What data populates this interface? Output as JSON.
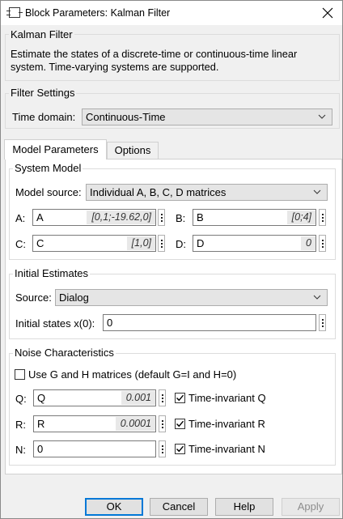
{
  "window": {
    "title": "Block Parameters: Kalman Filter"
  },
  "block": {
    "name": "Kalman Filter",
    "description": "Estimate the states of a discrete-time or continuous-time linear system. Time-varying systems are supported."
  },
  "filter_settings": {
    "group_label": "Filter Settings",
    "time_domain_label": "Time domain:",
    "time_domain_value": "Continuous-Time"
  },
  "tabs": [
    {
      "label": "Model Parameters",
      "active": true
    },
    {
      "label": "Options",
      "active": false
    }
  ],
  "system_model": {
    "group_label": "System Model",
    "model_source_label": "Model source:",
    "model_source_value": "Individual A, B, C, D matrices",
    "A": {
      "label": "A:",
      "value": "A",
      "hint": "[0,1;-19.62,0]"
    },
    "B": {
      "label": "B:",
      "value": "B",
      "hint": "[0;4]"
    },
    "C": {
      "label": "C:",
      "value": "C",
      "hint": "[1,0]"
    },
    "D": {
      "label": "D:",
      "value": "D",
      "hint": "0"
    }
  },
  "initial_estimates": {
    "group_label": "Initial Estimates",
    "source_label": "Source:",
    "source_value": "Dialog",
    "initial_states_label": "Initial states x(0):",
    "initial_states_value": "0"
  },
  "noise": {
    "group_label": "Noise Characteristics",
    "use_gh_label": "Use G and H matrices (default G=I and H=0)",
    "use_gh_checked": false,
    "Q": {
      "label": "Q:",
      "value": "Q",
      "hint": "0.001",
      "ti_label": "Time-invariant Q",
      "ti_checked": true
    },
    "R": {
      "label": "R:",
      "value": "R",
      "hint": "0.0001",
      "ti_label": "Time-invariant R",
      "ti_checked": true
    },
    "N": {
      "label": "N:",
      "value": "0",
      "hint": "",
      "ti_label": "Time-invariant N",
      "ti_checked": true
    }
  },
  "buttons": {
    "ok": "OK",
    "cancel": "Cancel",
    "help": "Help",
    "apply": "Apply"
  },
  "icons": {
    "app": "simulink-block-icon",
    "close": "close-icon",
    "dropdown": "chevron-down-icon",
    "more": "vertical-ellipsis-icon",
    "check": "checkmark-icon"
  },
  "colors": {
    "focus_border": "#0078d7",
    "panel_bg": "#f0f0f0",
    "tab_bg": "#ffffff"
  }
}
